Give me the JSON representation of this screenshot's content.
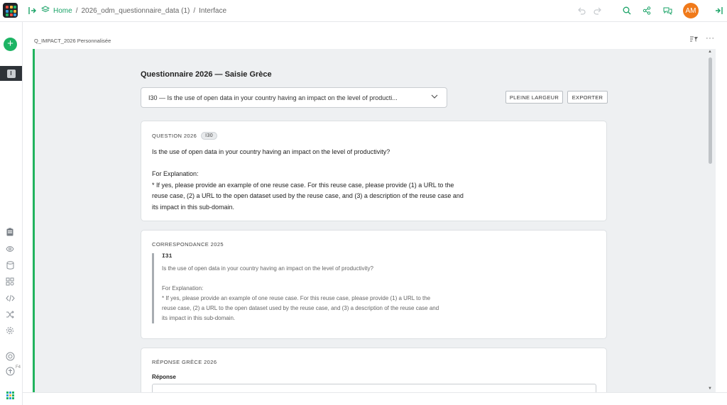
{
  "topbar": {
    "breadcrumb": {
      "home": "Home",
      "separator": "/",
      "document": "2026_odm_questionnaire_data (1)",
      "page": "Interface"
    },
    "avatar_initials": "AM"
  },
  "sidebar": {
    "add_label": "+",
    "current_page_letter": "I",
    "shortcut_hint": "F4"
  },
  "subheader": {
    "title": "Q_IMPACT_2026 Personnalisée",
    "more_label": "···"
  },
  "form": {
    "title": "Questionnaire 2026 — Saisie Grèce",
    "selected_question": "I30 — Is the use of open data in your country having an impact on the level of producti...",
    "full_width_button": "PLEINE LARGEUR",
    "export_button": "EXPORTER"
  },
  "question_card": {
    "label": "QUESTION 2026",
    "code_chip": "I30",
    "text": "Is the use of open data in your country having an impact on the level of productivity?\n\nFor Explanation:\n* If yes, please provide an example of one reuse case. For this reuse case, please provide (1) a URL to the\nreuse case, (2) a URL to the open dataset used by the reuse case, and (3) a description of the reuse case and\nits impact in this sub-domain."
  },
  "correspondence_card": {
    "label": "CORRESPONDANCE 2025",
    "code": "I31",
    "text": "Is the use of open data in your country having an impact on the level of productivity?\n\nFor Explanation:\n* If yes, please provide an example of one reuse case. For this reuse case, please provide (1) a URL to the\nreuse case, (2) a URL to the open dataset used by the reuse case, and (3) a description of the reuse case and\nits impact in this sub-domain."
  },
  "response_card": {
    "label": "RÉPONSE GRÈCE 2026",
    "field_label": "Réponse",
    "field_value": ""
  },
  "colors": {
    "accent_green": "#22b35e",
    "avatar_orange": "#f07a1a",
    "canvas_bg": "#eef0f2"
  },
  "icons": [
    "grist-logo-icon",
    "panel-toggle-icon",
    "layers-icon",
    "undo-icon",
    "redo-icon",
    "search-icon",
    "share-icon",
    "comments-icon",
    "right-panel-icon",
    "chevron-down-icon",
    "raw-data-icon",
    "eye-icon",
    "database-icon",
    "widgets-icon",
    "code-icon",
    "shuffle-icon",
    "settings-icon",
    "help-icon",
    "accessibility-icon",
    "sort-filter-icon"
  ]
}
